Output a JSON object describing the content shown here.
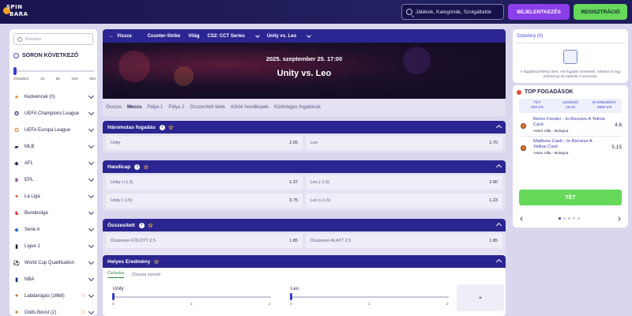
{
  "header": {
    "logo_line1": "SPIN",
    "logo_line2": "BARA",
    "search_placeholder": "Játékok, Kategóriák, Szolgáltatók",
    "login_label": "BEJELENTKEZÉS",
    "register_label": "REGISZTRÁCIÓ"
  },
  "sidebar": {
    "search_placeholder": "Keresés",
    "next_label": "SORON KÖVETKEZŐ",
    "time_filter": {
      "labels": [
        "ÖSSZES",
        "10",
        "60",
        "240",
        "480"
      ],
      "selected": "ÖSSZES"
    },
    "items": [
      {
        "label": "Kedvencek (0)",
        "icon": "star-icon"
      },
      {
        "label": "UEFA Champions League",
        "icon": "ucl-icon"
      },
      {
        "label": "UEFA Europa League",
        "icon": "uel-icon"
      },
      {
        "label": "MLB",
        "icon": "mlb-icon"
      },
      {
        "label": "AFL",
        "icon": "afl-icon"
      },
      {
        "label": "EPL",
        "icon": "epl-icon"
      },
      {
        "label": "La Liga",
        "icon": "laliga-icon"
      },
      {
        "label": "Bundesliga",
        "icon": "bundesliga-icon"
      },
      {
        "label": "Serie A",
        "icon": "seriea-icon"
      },
      {
        "label": "Ligue 1",
        "icon": "ligue1-icon"
      },
      {
        "label": "World Cup Qualification",
        "icon": "football-icon"
      },
      {
        "label": "NBA",
        "icon": "nba-icon"
      },
      {
        "label": "Labdarúgás (1668)",
        "icon": "football-icon"
      },
      {
        "label": "Odds Boost (2)",
        "icon": "boost-icon"
      }
    ]
  },
  "breadcrumb": {
    "back": "Vissza",
    "items": [
      "Counter-Strike",
      "Világ",
      "CS2: CCT Series",
      "Unity vs. Leo"
    ]
  },
  "event": {
    "date": "2025. szeptember 25. 17:00",
    "title": "Unity vs. Leo"
  },
  "tabs": [
    "Összes",
    "Meccs",
    "Pálya 1",
    "Pálya 2",
    "Összesített tétek",
    "Körök hendikepek",
    "Különleges fogadások"
  ],
  "active_tab": "Meccs",
  "markets": {
    "threeway": {
      "title": "Háromutas fogadás",
      "outcomes": [
        {
          "name": "Unity",
          "odds": "2.05"
        },
        {
          "name": "Leo",
          "odds": "1.70"
        }
      ]
    },
    "handicap": {
      "title": "Handicap",
      "outcomes": [
        {
          "name": "Unity (+1.5)",
          "odds": "1.37"
        },
        {
          "name": "Leo (-1.5)",
          "odds": "2.90"
        },
        {
          "name": "Unity (-1.5)",
          "odds": "3.75"
        },
        {
          "name": "Leo (+1.5)",
          "odds": "1.23"
        }
      ]
    },
    "total": {
      "title": "Összesített",
      "outcomes": [
        {
          "name": "Összesen FÖLÖTT 2.5",
          "odds": "1.85"
        },
        {
          "name": "Összesen ALATT 2.5",
          "odds": "1.85"
        }
      ]
    },
    "correct_score": {
      "title": "Helyes Eredmény",
      "tabs": [
        "Csúszka",
        "Összes szorzó"
      ],
      "home": "Unity",
      "away": "Leo",
      "home_ticks": [
        "0",
        "1",
        "2"
      ],
      "away_ticks": [
        "0",
        "1",
        "2"
      ]
    }
  },
  "betslip": {
    "title": "Szelvény (0)",
    "empty_text": "A fogadószelvény üres. Ha fogadni szeretnél, válassz ki egy eseményt és kattints a szorzóra."
  },
  "top_bets": {
    "title": "TOP FOGADÁSOK",
    "headers": {
      "stake_label": "TÉT",
      "stake_value": "200 KR",
      "odds_label": "SZORZÓ",
      "odds_value": "19.25",
      "win_label": "NYEREMÉNY",
      "win_value": "3850 KR"
    },
    "tips": [
      {
        "title": "Remo Freuler - to Receive A Yellow Card",
        "match": "Aston Villa - Bologna",
        "odds": "4.6"
      },
      {
        "title": "Matthew Cash - to Receive A Yellow Card",
        "match": "Aston Villa - Bologna",
        "odds": "5.15"
      }
    ],
    "bet_button": "TÉT",
    "page_count": 5,
    "active_page": 1
  },
  "colors": {
    "accent": "#2a2590",
    "green": "#66d85a",
    "purple": "#8a3fe8",
    "star": "#f0b040"
  }
}
